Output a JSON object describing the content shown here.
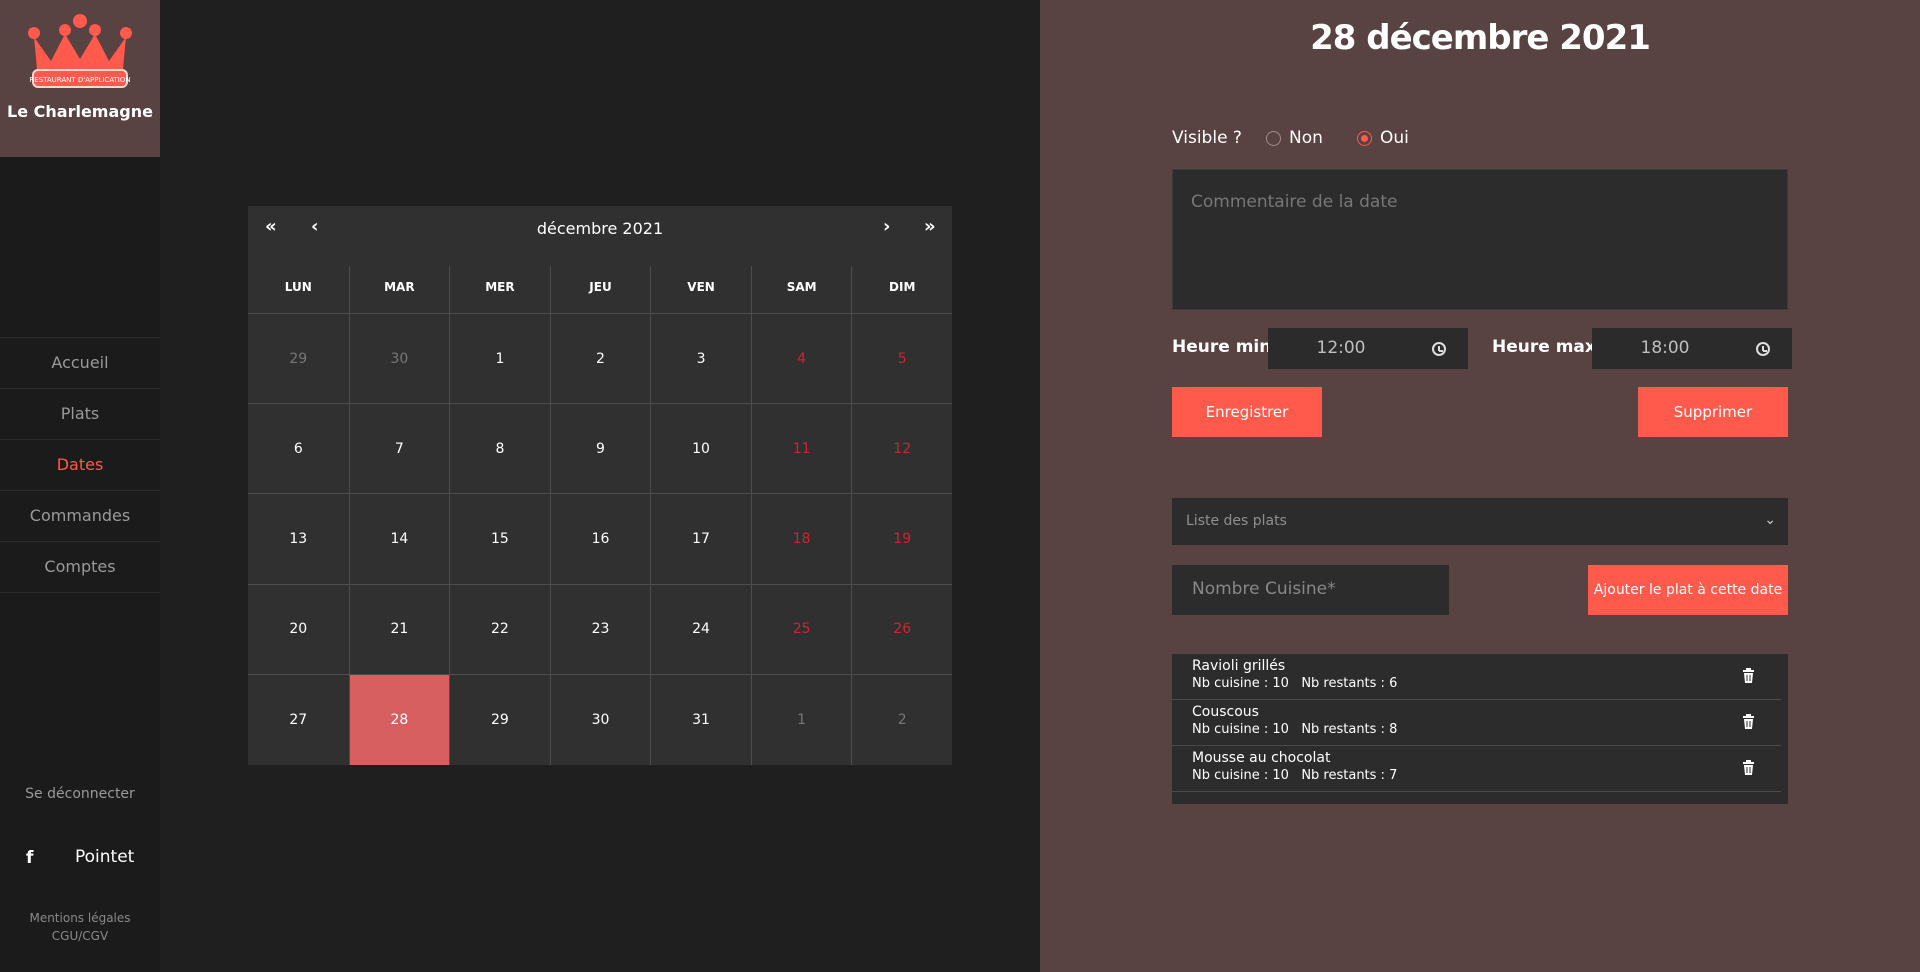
{
  "brand": {
    "logo_text": "RESTAURANT D'APPLICATION",
    "name": "Le Charlemagne"
  },
  "sidebar": {
    "items": [
      {
        "label": "Accueil",
        "active": false
      },
      {
        "label": "Plats",
        "active": false
      },
      {
        "label": "Dates",
        "active": true
      },
      {
        "label": "Commandes",
        "active": false
      },
      {
        "label": "Comptes",
        "active": false
      }
    ],
    "logout": "Se déconnecter",
    "facebook_icon": "f",
    "facebook_label": "Pointet",
    "legal": [
      "Mentions légales",
      "CGU/CGV"
    ]
  },
  "calendar": {
    "month_label": "décembre 2021",
    "nav": {
      "first": "«",
      "prev": "‹",
      "next": "›",
      "last": "»"
    },
    "weekdays": [
      "LUN",
      "MAR",
      "MER",
      "JEU",
      "VEN",
      "SAM",
      "DIM"
    ],
    "weeks": [
      [
        "29",
        "30",
        "1",
        "2",
        "3",
        "4",
        "5"
      ],
      [
        "6",
        "7",
        "8",
        "9",
        "10",
        "11",
        "12"
      ],
      [
        "13",
        "14",
        "15",
        "16",
        "17",
        "18",
        "19"
      ],
      [
        "20",
        "21",
        "22",
        "23",
        "24",
        "25",
        "26"
      ],
      [
        "27",
        "28",
        "29",
        "30",
        "31",
        "1",
        "2"
      ]
    ],
    "selected_day": "28"
  },
  "detail": {
    "title": "28 décembre 2021",
    "visible_label": "Visible ?",
    "options": [
      "Non",
      "Oui"
    ],
    "selected_option": "Oui",
    "comment_placeholder": "Commentaire de la date",
    "hour_min_label": "Heure min :",
    "hour_min": "12:00",
    "hour_max_label": "Heure max :",
    "hour_max": "18:00",
    "save_label": "Enregistrer",
    "delete_label": "Supprimer",
    "select_placeholder": "Liste des plats",
    "count_placeholder": "Nombre Cuisine*",
    "add_label": "Ajouter le plat à cette date",
    "dishes": [
      {
        "name": "Ravioli grillés",
        "stats": "Nb cuisine : 10   Nb restants : 6"
      },
      {
        "name": "Couscous",
        "stats": "Nb cuisine : 10   Nb restants : 8"
      },
      {
        "name": "Mousse au chocolat",
        "stats": "Nb cuisine : 10   Nb restants : 7"
      }
    ]
  },
  "colors": {
    "accent": "#ff5a4b",
    "panel": "#584242",
    "weekend": "#cf2430"
  }
}
